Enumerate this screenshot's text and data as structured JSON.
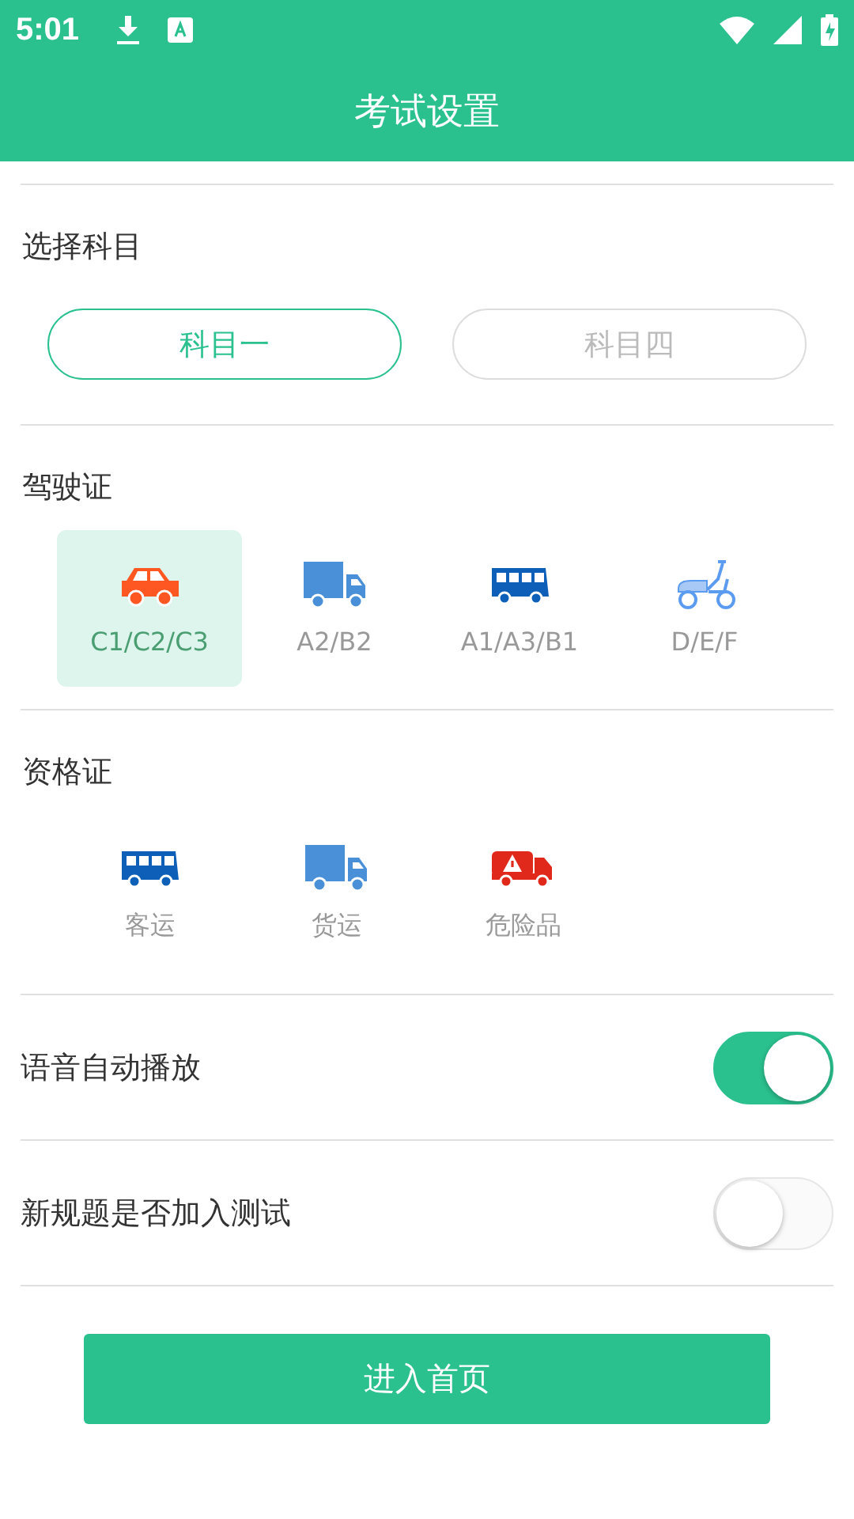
{
  "status_bar": {
    "time": "5:01"
  },
  "header": {
    "title": "考试设置"
  },
  "subject": {
    "label": "选择科目",
    "options": [
      {
        "label": "科目一",
        "selected": true
      },
      {
        "label": "科目四",
        "selected": false
      }
    ]
  },
  "license": {
    "label": "驾驶证",
    "items": [
      {
        "kind": "car",
        "label": "C1/C2/C3",
        "selected": true
      },
      {
        "kind": "truck",
        "label": "A2/B2",
        "selected": false
      },
      {
        "kind": "bus",
        "label": "A1/A3/B1",
        "selected": false
      },
      {
        "kind": "scooter",
        "label": "D/E/F",
        "selected": false
      }
    ]
  },
  "qualification": {
    "label": "资格证",
    "items": [
      {
        "kind": "bus",
        "label": "客运",
        "selected": false
      },
      {
        "kind": "truck",
        "label": "货运",
        "selected": false
      },
      {
        "kind": "hazard",
        "label": "危险品",
        "selected": false
      }
    ]
  },
  "settings": [
    {
      "label": "语音自动播放",
      "on": true
    },
    {
      "label": "新规题是否加入测试",
      "on": false
    }
  ],
  "button": {
    "label": "进入首页"
  }
}
